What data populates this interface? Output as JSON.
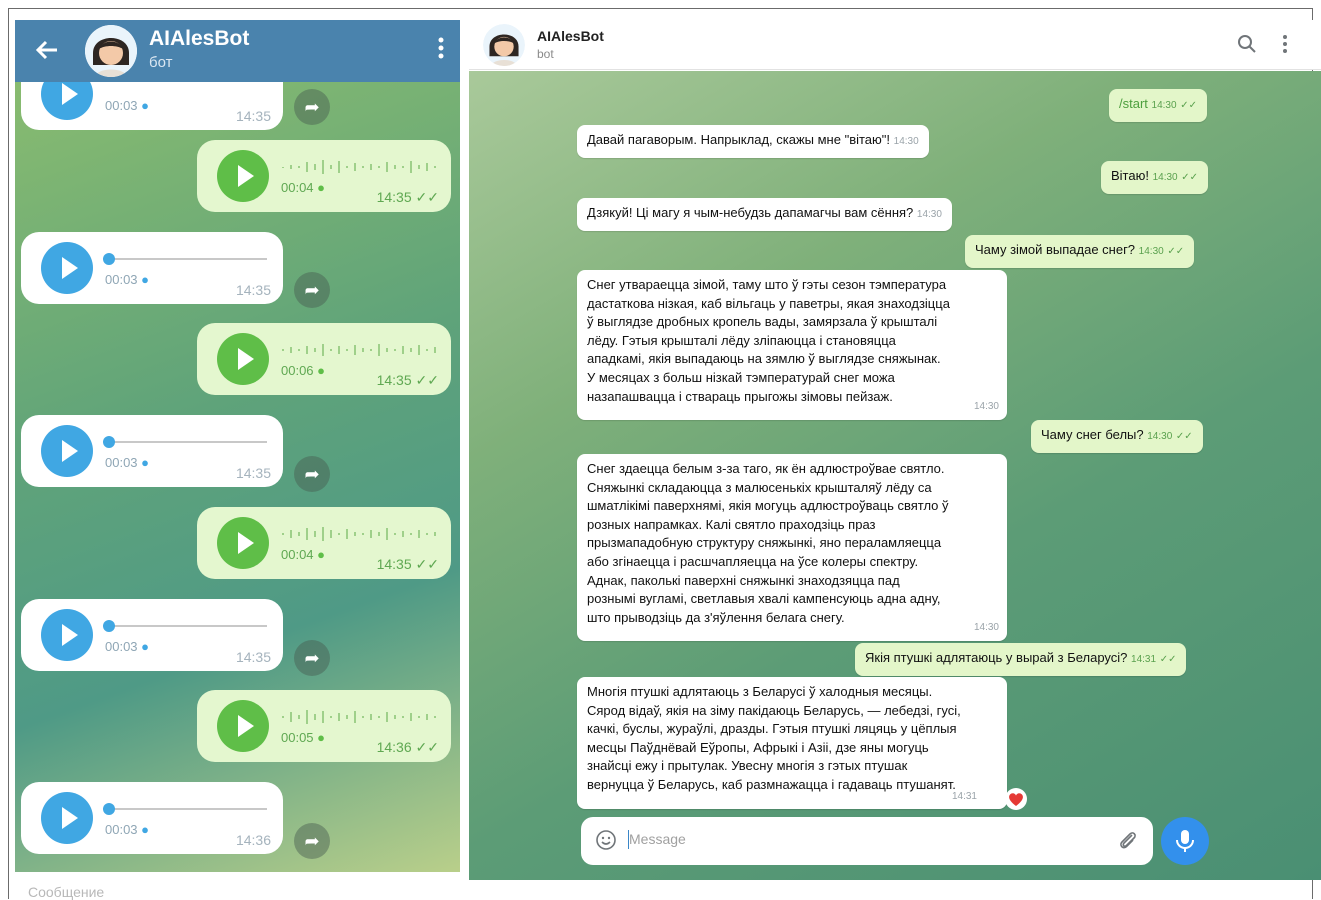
{
  "mobile": {
    "title": "AIAlesBot",
    "subtitle": "бот",
    "messages": [
      {
        "dir": "in",
        "duration": "00:03",
        "time": "14:35"
      },
      {
        "dir": "out",
        "duration": "00:04",
        "time": "14:35"
      },
      {
        "dir": "in",
        "duration": "00:03",
        "time": "14:35"
      },
      {
        "dir": "out",
        "duration": "00:06",
        "time": "14:35"
      },
      {
        "dir": "in",
        "duration": "00:03",
        "time": "14:35"
      },
      {
        "dir": "out",
        "duration": "00:04",
        "time": "14:35"
      },
      {
        "dir": "in",
        "duration": "00:03",
        "time": "14:35"
      },
      {
        "dir": "out",
        "duration": "00:05",
        "time": "14:36"
      },
      {
        "dir": "in",
        "duration": "00:03",
        "time": "14:36"
      }
    ],
    "input_placeholder": "Сообщение"
  },
  "desktop": {
    "title": "AIAlesBot",
    "subtitle": "bot",
    "messages": [
      {
        "dir": "out",
        "text": "/start",
        "time": "14:30"
      },
      {
        "dir": "in",
        "text": "Давай пагаворым. Напрыклад, скажы мне \"вітаю\"!",
        "time": "14:30"
      },
      {
        "dir": "out",
        "text": "Вітаю!",
        "time": "14:30"
      },
      {
        "dir": "in",
        "text": "Дзякуй! Ці магу я чым-небудзь дапамагчы вам сёння?",
        "time": "14:30"
      },
      {
        "dir": "out",
        "text": "Чаму зімой выпадае снег?",
        "time": "14:30"
      },
      {
        "dir": "in",
        "text": "Снег утвараецца зімой, таму што ў гэты сезон тэмпература\nдастаткова нізкая, каб вільгаць у паветры, якая знаходзіцца\nў выглядзе дробных кропель вады, замярзала ў крышталі\nлёду. Гэтыя крышталі лёду зліпаюцца і становяцца\nападкамі, якія выпадаюць на зямлю ў выглядзе сняжынак.\nУ месяцах з больш нізкай тэмпературай снег можа\nназапашвацца і ствараць прыгожы зімовы пейзаж.",
        "time": "14:30"
      },
      {
        "dir": "out",
        "text": "Чаму снег белы?",
        "time": "14:30"
      },
      {
        "dir": "in",
        "text": "Снег здаецца белым з-за таго, як ён адлюстроўвае святло.\nСняжынкі складаюцца з малюсенькіх крышталяў лёду са\nшматлікімі паверхнямі, якія могуць адлюстроўваць святло ў\nрозных напрамках. Калі святло праходзіць праз\nпрызмападобную структуру сняжынкі, яно пераламляецца\nабо згінаецца і расшчапляецца на ўсе колеры спектру.\nАднак, паколькі паверхні сняжынкі знаходзяцца пад\nрознымі вугламі, светлавыя хвалі кампенсуюць адна адну,\nшто прыводзіць да з'яўлення белага снегу.",
        "time": "14:30"
      },
      {
        "dir": "out",
        "text": "Якія птушкі адлятаюць у вырай з Беларусі?",
        "time": "14:31"
      },
      {
        "dir": "in",
        "text": "Многія птушкі адлятаюць з Беларусі ў халодныя месяцы.\nСярод відаў, якія на зіму пакідаюць Беларусь, — лебедзі, гусі,\nкачкі, буслы, жураўлі, дразды. Гэтыя птушкі ляцяць у цёплыя\nмесцы Паўднёвай Еўропы, Афрыкі і Азіі, дзе яны могуць\nзнайсці ежу і прытулак. Увесну многія з гэтых птушак\nвернуцца ў Беларусь, каб размнажацца і гадаваць птушанят.",
        "time": "14:31"
      }
    ],
    "input_placeholder": "Message"
  },
  "colors": {
    "header_blue": "#4a83ad",
    "play_in": "#40a7e3",
    "play_out": "#5fbe48",
    "mic_button": "#3390ec",
    "heart": "#e53935"
  },
  "icons": [
    "back-arrow-icon",
    "kebab-menu-icon",
    "play-icon",
    "forward-icon",
    "search-icon",
    "emoji-icon",
    "attach-icon",
    "mic-icon",
    "heart-icon"
  ]
}
